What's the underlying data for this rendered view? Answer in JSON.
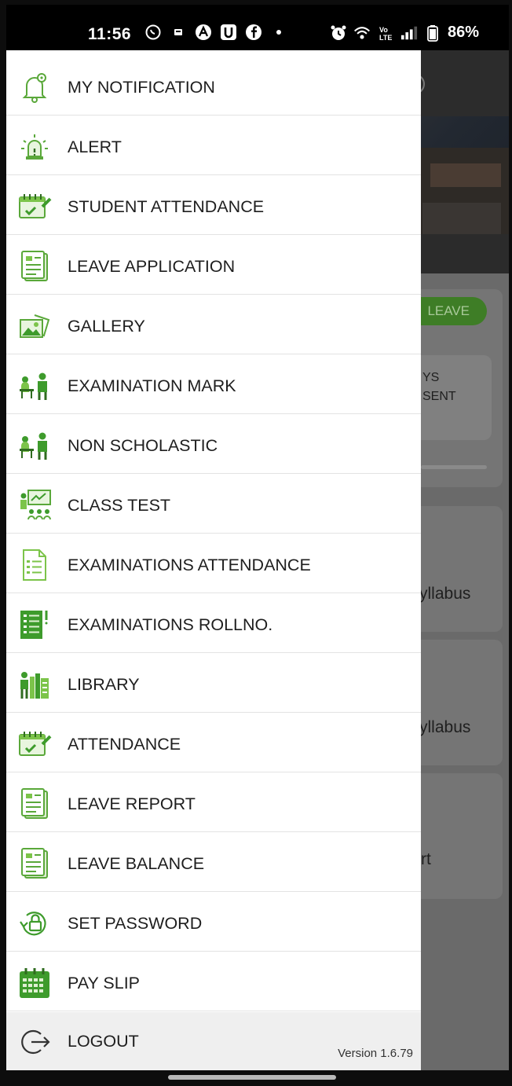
{
  "status_bar": {
    "time": "11:56",
    "battery": "86%",
    "left_icons": [
      "whatsapp-icon",
      "notification-icon",
      "app-a-icon",
      "app-u-icon",
      "facebook-icon",
      "dot-icon"
    ],
    "right_icons": [
      "alarm-icon",
      "wifi-icon",
      "volte-icon",
      "signal-icon",
      "battery-icon"
    ]
  },
  "background": {
    "leave_button": "LEAVE",
    "days_present_line1": "YS",
    "days_present_line2": "SENT",
    "syllabus_1": "yllabus",
    "syllabus_2": "yllabus",
    "alert_partial": "rt"
  },
  "menu": {
    "items": [
      {
        "label": "MY NOTIFICATION",
        "icon": "bell-icon"
      },
      {
        "label": "ALERT",
        "icon": "siren-icon"
      },
      {
        "label": "STUDENT ATTENDANCE",
        "icon": "attendance-icon"
      },
      {
        "label": "LEAVE APPLICATION",
        "icon": "document-list-icon"
      },
      {
        "label": "GALLERY",
        "icon": "gallery-icon"
      },
      {
        "label": "EXAMINATION MARK",
        "icon": "exam-desk-icon"
      },
      {
        "label": "NON SCHOLASTIC",
        "icon": "exam-desk-icon"
      },
      {
        "label": "CLASS TEST",
        "icon": "class-presentation-icon"
      },
      {
        "label": "EXAMINATIONS ATTENDANCE",
        "icon": "paper-list-icon"
      },
      {
        "label": "EXAMINATIONS ROLLNO.",
        "icon": "roll-list-icon"
      },
      {
        "label": "LIBRARY",
        "icon": "library-icon"
      },
      {
        "label": "ATTENDANCE",
        "icon": "attendance-icon"
      },
      {
        "label": "LEAVE REPORT",
        "icon": "document-list-icon"
      },
      {
        "label": "LEAVE BALANCE",
        "icon": "document-list-icon"
      },
      {
        "label": "SET PASSWORD",
        "icon": "lock-refresh-icon"
      },
      {
        "label": "PAY SLIP",
        "icon": "calendar-icon"
      }
    ],
    "logout_label": "LOGOUT",
    "version": "Version 1.6.79"
  },
  "colors": {
    "accent_green": "#3e9b2c",
    "icon_light_green": "#7cc44a",
    "drawer_bg": "#ffffff",
    "overlay_bg": "#6e6e6e"
  }
}
